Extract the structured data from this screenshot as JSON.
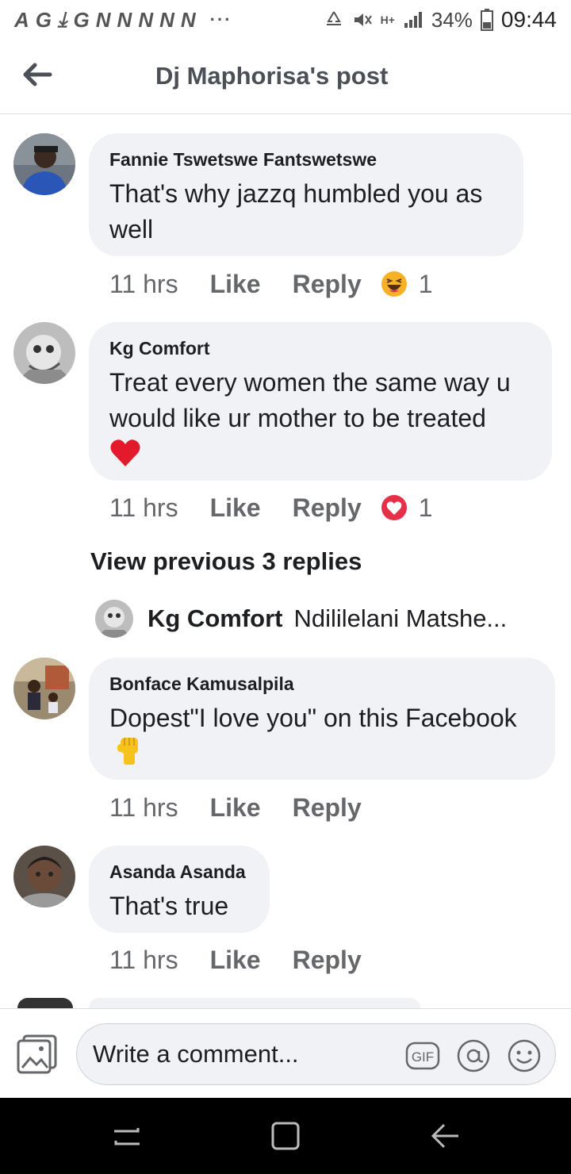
{
  "status_bar": {
    "left_icons": [
      "A",
      "G",
      "⤓",
      "G",
      "N",
      "N",
      "N",
      "N",
      "N"
    ],
    "dots": "···",
    "signal_label": "H+",
    "battery": "34%",
    "time": "09:44"
  },
  "header": {
    "title": "Dj Maphorisa's post"
  },
  "comments": [
    {
      "author": "Fannie Tswetswe Fantswetswe",
      "text": "That's why jazzq humbled you as well",
      "time": "11 hrs",
      "like_label": "Like",
      "reply_label": "Reply",
      "reaction_icon": "haha-icon",
      "reaction_count": "1"
    },
    {
      "author": "Kg Comfort",
      "text": "Treat every women the same way u would like ur mother to be treated",
      "emoji": "❤️",
      "time": "11 hrs",
      "like_label": "Like",
      "reply_label": "Reply",
      "reaction_icon": "love-icon",
      "reaction_count": "1"
    },
    {
      "author": "Bonface Kamusalpila",
      "text": "Dopest\"I love you\" on this Facebook",
      "emoji": "✊",
      "time": "11 hrs",
      "like_label": "Like",
      "reply_label": "Reply"
    },
    {
      "author": "Asanda Asanda",
      "text": "That's true",
      "time": "11 hrs",
      "like_label": "Like",
      "reply_label": "Reply"
    }
  ],
  "replies": {
    "view_previous_label": "View previous 3 replies",
    "preview_author": "Kg Comfort",
    "preview_text": "Ndililelani Matshe..."
  },
  "composer": {
    "placeholder": "Write a comment...",
    "gif_label": "GIF"
  },
  "colors": {
    "bubble": "#f0f2f5",
    "meta_text": "#65676b",
    "love": "#e5304a",
    "haha": "#f7b125"
  }
}
